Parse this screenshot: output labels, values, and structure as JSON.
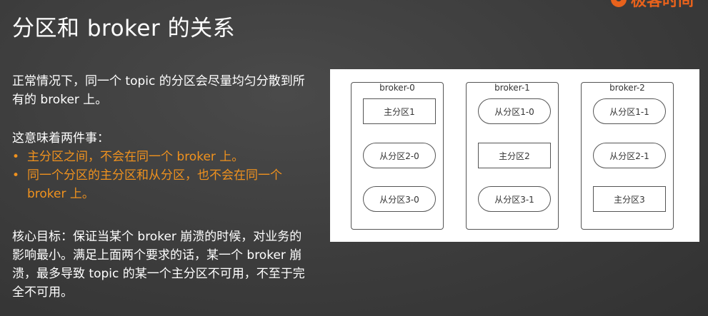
{
  "slide": {
    "title": "分区和 broker 的关系",
    "logo_text": "极客时间"
  },
  "text": {
    "paragraph1": "正常情况下，同一个 topic 的分区会尽量均匀分散到所有的 broker 上。",
    "paragraph2": "这意味着两件事：",
    "bullets": [
      "主分区之间，不会在同一个 broker 上。",
      "同一个分区的主分区和从分区，也不会在同一个 broker 上。"
    ],
    "paragraph3": "核心目标：保证当某个 broker 崩溃的时候，对业务的影响最小。满足上面两个要求的话，某一个 broker 崩溃，最多导致 topic 的某一个主分区不可用，不至于完全不可用。"
  },
  "diagram": {
    "brokers": [
      {
        "name": "broker-0",
        "partitions": [
          {
            "label": "主分区1",
            "role": "leader"
          },
          {
            "label": "从分区2-0",
            "role": "follower"
          },
          {
            "label": "从分区3-0",
            "role": "follower"
          }
        ]
      },
      {
        "name": "broker-1",
        "partitions": [
          {
            "label": "从分区1-0",
            "role": "follower"
          },
          {
            "label": "主分区2",
            "role": "leader"
          },
          {
            "label": "从分区3-1",
            "role": "follower"
          }
        ]
      },
      {
        "name": "broker-2",
        "partitions": [
          {
            "label": "从分区1-1",
            "role": "follower"
          },
          {
            "label": "从分区2-1",
            "role": "follower"
          },
          {
            "label": "主分区3",
            "role": "leader"
          }
        ]
      }
    ]
  },
  "colors": {
    "accent": "#f0921e",
    "background": "#3c3c3c",
    "logo": "#e8621c"
  }
}
